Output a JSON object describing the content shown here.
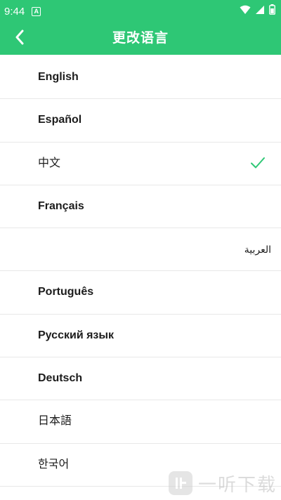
{
  "status_bar": {
    "time": "9:44",
    "notification_glyph": "A",
    "icons": [
      "wifi-icon",
      "signal-icon",
      "battery-icon"
    ]
  },
  "app_bar": {
    "title": "更改语言",
    "back_icon": "chevron-left-icon"
  },
  "languages": [
    {
      "label": "English",
      "selected": false
    },
    {
      "label": "Español",
      "selected": false
    },
    {
      "label": "中文",
      "selected": true
    },
    {
      "label": "Français",
      "selected": false
    },
    {
      "label": "العربية",
      "selected": false
    },
    {
      "label": "Português",
      "selected": false
    },
    {
      "label": "Русский язык",
      "selected": false
    },
    {
      "label": "Deutsch",
      "selected": false
    },
    {
      "label": "日本語",
      "selected": false
    },
    {
      "label": "한국어",
      "selected": false
    }
  ],
  "watermark": {
    "text": "一听下载"
  },
  "colors": {
    "accent": "#2ec775",
    "check": "#2ec775",
    "text": "#1c1c1c",
    "divider": "#e8e8e8"
  }
}
